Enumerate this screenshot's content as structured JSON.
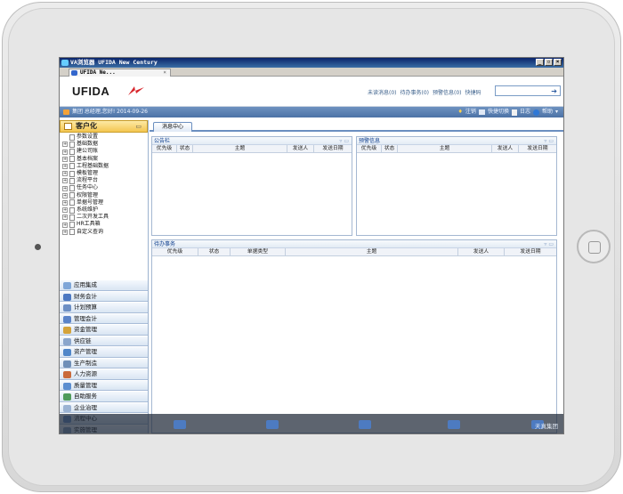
{
  "window": {
    "title": "VA浏览器  UFIDA New Century",
    "buttons": [
      "_",
      "▫",
      "×"
    ]
  },
  "browser_tab": {
    "label": "UFIDA Ne...",
    "close": "×"
  },
  "header": {
    "logo": "UFIDA",
    "links": [
      "未读消息(0)",
      "待办事务(0)",
      "预警信息(0)",
      "快捷码"
    ],
    "search": {
      "value": "",
      "button": "➔"
    }
  },
  "userbar": {
    "greeting": "集团 总经理,您好! 2014-09-26",
    "actions": [
      "注销",
      "快捷切换",
      "日志",
      "帮助"
    ]
  },
  "sidebar": {
    "title": "客户化",
    "tree": [
      {
        "label": "参数设置",
        "expand": ""
      },
      {
        "label": "基础数据",
        "expand": "+"
      },
      {
        "label": "建公司账",
        "expand": "+"
      },
      {
        "label": "基本档案",
        "expand": "+"
      },
      {
        "label": "工程基础数据",
        "expand": "+"
      },
      {
        "label": "模板管理",
        "expand": "+"
      },
      {
        "label": "流程平台",
        "expand": "+"
      },
      {
        "label": "任务中心",
        "expand": "+"
      },
      {
        "label": "权限管理",
        "expand": "+"
      },
      {
        "label": "单据号管理",
        "expand": "+"
      },
      {
        "label": "系统维护",
        "expand": "+"
      },
      {
        "label": "二次开发工具",
        "expand": "+"
      },
      {
        "label": "HR工具箱",
        "expand": "+"
      },
      {
        "label": "自定义查询",
        "expand": "+"
      }
    ],
    "modules": [
      {
        "label": "应用集成",
        "color": "#7ea6d8"
      },
      {
        "label": "财务会计",
        "color": "#4b78c2"
      },
      {
        "label": "计划预算",
        "color": "#6c8fc4"
      },
      {
        "label": "管理会计",
        "color": "#5a83c8"
      },
      {
        "label": "资金管理",
        "color": "#d4a33a"
      },
      {
        "label": "供应链",
        "color": "#8aa6cc"
      },
      {
        "label": "资产管理",
        "color": "#4f86c9"
      },
      {
        "label": "生产制造",
        "color": "#6f8fb8"
      },
      {
        "label": "人力资源",
        "color": "#c96a3b"
      },
      {
        "label": "质量管理",
        "color": "#5b8ed0"
      },
      {
        "label": "自助服务",
        "color": "#4f9b5a"
      },
      {
        "label": "企业治理",
        "color": "#9bb3d3"
      },
      {
        "label": "流程中心",
        "color": "#6d95cc"
      },
      {
        "label": "实施管理",
        "color": "#8aa0c0"
      }
    ]
  },
  "content": {
    "tab": "消息中心",
    "bulletin": {
      "title": "公告栏",
      "columns": [
        "优先级",
        "状态",
        "主题",
        "发送人",
        "发送日期"
      ]
    },
    "alerts": {
      "title": "预警信息",
      "columns": [
        "优先级",
        "状态",
        "主题",
        "发送人",
        "发送日期"
      ]
    },
    "todo": {
      "title": "待办事务",
      "columns": [
        "优先级",
        "状态",
        "单据类型",
        "主题",
        "发送人",
        "发送日期"
      ]
    }
  },
  "taskbar": {
    "label": "天真集团"
  }
}
